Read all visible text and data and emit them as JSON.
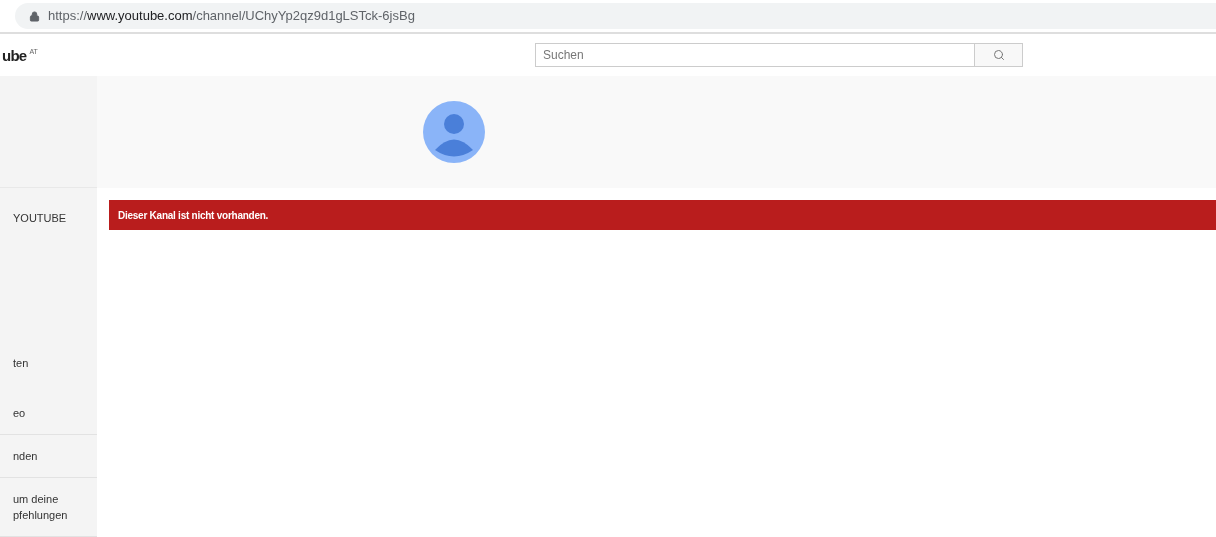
{
  "address_bar": {
    "scheme": "https://",
    "host": "www.youtube.com",
    "path": "/channel/UChyYp2qz9d1gLSTck-6jsBg"
  },
  "header": {
    "logo": "ube",
    "region": "AT",
    "search": {
      "placeholder": "Suchen"
    }
  },
  "sidebar": {
    "sections": [
      {
        "items": [
          {
            "label": "YOUTUBE"
          },
          {
            "label": "ten"
          },
          {
            "label": "eo"
          }
        ]
      },
      {
        "items": [
          {
            "label": "nden"
          }
        ]
      },
      {
        "items": [
          {
            "label": "um deine\npfehlungen"
          }
        ]
      }
    ]
  },
  "alert": {
    "message": "Dieser Kanal ist nicht vorhanden."
  }
}
